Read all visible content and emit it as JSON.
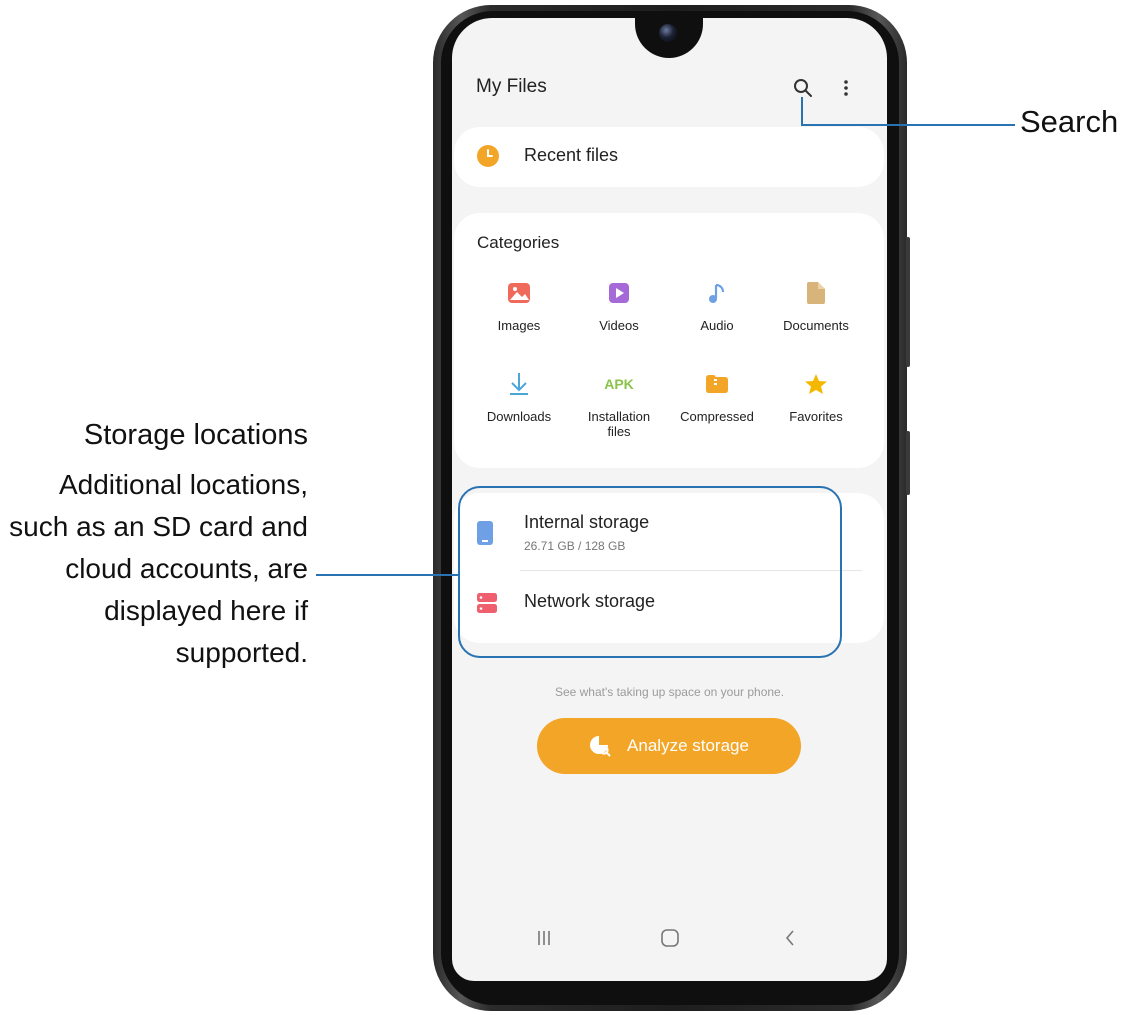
{
  "app": {
    "title": "My Files"
  },
  "header": {
    "search_icon": "search-icon",
    "more_icon": "more-options-icon"
  },
  "recent": {
    "label": "Recent files",
    "icon": "clock-icon"
  },
  "categories": {
    "title": "Categories",
    "items": [
      {
        "label": "Images",
        "icon": "images-icon",
        "color": "#ef6a5b"
      },
      {
        "label": "Videos",
        "icon": "videos-icon",
        "color": "#a56ad7"
      },
      {
        "label": "Audio",
        "icon": "audio-icon",
        "color": "#6fa0e6"
      },
      {
        "label": "Documents",
        "icon": "documents-icon",
        "color": "#d8b47a"
      },
      {
        "label": "Downloads",
        "icon": "downloads-icon",
        "color": "#4aa7d8"
      },
      {
        "label": "Installation\nfiles",
        "icon": "apk-icon",
        "icon_text": "APK",
        "color": "#8bc34a"
      },
      {
        "label": "Compressed",
        "icon": "compressed-icon",
        "color": "#f2a527"
      },
      {
        "label": "Favorites",
        "icon": "favorites-icon",
        "color": "#f5b800"
      }
    ]
  },
  "storage": {
    "items": [
      {
        "label": "Internal storage",
        "sub": "26.71 GB / 128 GB",
        "icon": "phone-storage-icon",
        "color": "#6fa0e6"
      },
      {
        "label": "Network storage",
        "icon": "network-storage-icon",
        "color": "#ef5f6e"
      }
    ]
  },
  "analyze": {
    "hint": "See what's taking up space on your phone.",
    "button_label": "Analyze storage",
    "color": "#f2a527"
  },
  "navbar": {
    "recents_icon": "recents-icon",
    "home_icon": "home-icon",
    "back_icon": "back-icon"
  },
  "callouts": {
    "search": "Search",
    "storage_title": "Storage locations",
    "storage_body": "Additional locations, such as an SD card and cloud accounts, are displayed here if supported.",
    "accent": "#2a73b3"
  }
}
